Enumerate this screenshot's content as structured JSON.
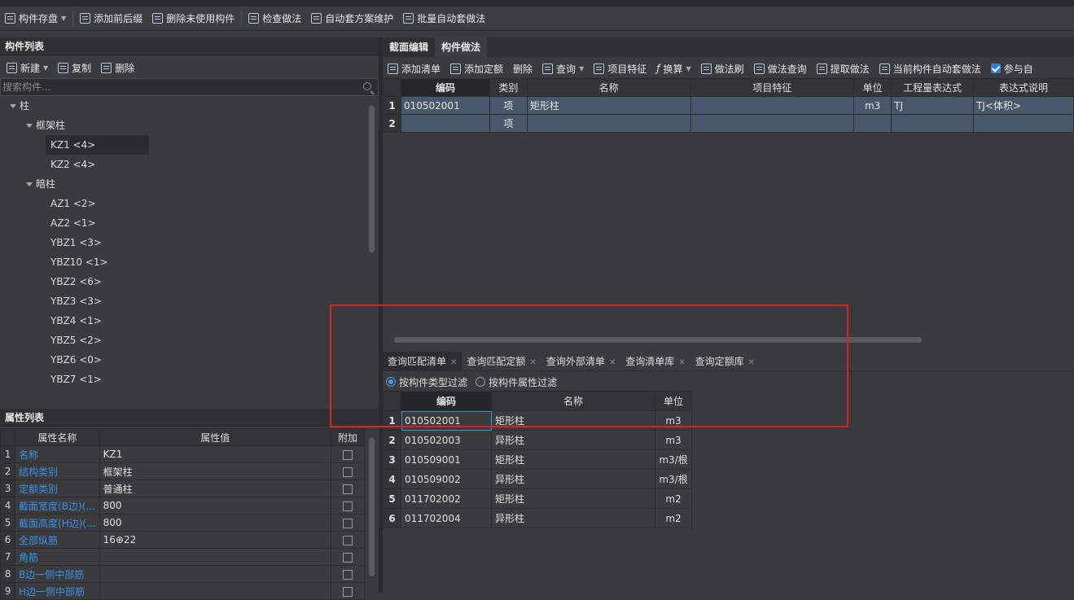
{
  "toolbar": {
    "items": [
      "构件存盘",
      "添加前后缀",
      "删除未使用构件",
      "检查做法",
      "自动套方案维护",
      "批量自动套做法"
    ]
  },
  "component_list": {
    "title": "构件列表",
    "tools": [
      "新建",
      "复制",
      "删除"
    ],
    "search_placeholder": "搜索构件...",
    "tree": {
      "root": "柱",
      "groups": [
        {
          "label": "框架柱",
          "items": [
            "KZ1 <4>",
            "KZ2 <4>"
          ]
        },
        {
          "label": "暗柱",
          "items": [
            "AZ1 <2>",
            "AZ2 <1>",
            "YBZ1 <3>",
            "YBZ10 <1>",
            "YBZ2 <6>",
            "YBZ3 <3>",
            "YBZ4 <1>",
            "YBZ5 <2>",
            "YBZ6 <0>",
            "YBZ7 <1>"
          ]
        }
      ],
      "selected": "KZ1 <4>"
    }
  },
  "property_list": {
    "title": "属性列表",
    "headers": [
      "属性名称",
      "属性值",
      "附加"
    ],
    "rows": [
      {
        "idx": "1",
        "name": "名称",
        "value": "KZ1"
      },
      {
        "idx": "2",
        "name": "结构类别",
        "value": "框架柱"
      },
      {
        "idx": "3",
        "name": "定额类别",
        "value": "普通柱"
      },
      {
        "idx": "4",
        "name": "截面宽度(B边)(...",
        "value": "800"
      },
      {
        "idx": "5",
        "name": "截面高度(H边)(...",
        "value": "800"
      },
      {
        "idx": "6",
        "name": "全部纵筋",
        "value": "16⊕22"
      },
      {
        "idx": "7",
        "name": "角筋",
        "value": ""
      },
      {
        "idx": "8",
        "name": "B边一侧中部筋",
        "value": ""
      },
      {
        "idx": "9",
        "name": "H边一侧中部筋",
        "value": ""
      }
    ]
  },
  "right_tabs": [
    "截面编辑",
    "构件做法"
  ],
  "method_tools": [
    "添加清单",
    "添加定额",
    "删除",
    "查询",
    "项目特征",
    "换算",
    "做法刷",
    "做法查询",
    "提取做法",
    "当前构件自动套做法",
    "参与自"
  ],
  "method_table": {
    "headers": [
      "编码",
      "类别",
      "名称",
      "项目特征",
      "单位",
      "工程量表达式",
      "表达式说明"
    ],
    "rows": [
      {
        "idx": "1",
        "code": "010502001",
        "cat": "项",
        "name": "矩形柱",
        "feature": "",
        "unit": "m3",
        "expr": "TJ",
        "desc": "TJ<体积>"
      },
      {
        "idx": "2",
        "code": "",
        "cat": "项",
        "name": "",
        "feature": "",
        "unit": "",
        "expr": "",
        "desc": ""
      }
    ]
  },
  "query_tabs": [
    "查询匹配清单",
    "查询匹配定额",
    "查询外部清单",
    "查询清单库",
    "查询定额库"
  ],
  "filters": [
    "按构件类型过滤",
    "按构件属性过滤"
  ],
  "query_table": {
    "headers": [
      "编码",
      "名称",
      "单位"
    ],
    "rows": [
      {
        "idx": "1",
        "code": "010502001",
        "name": "矩形柱",
        "unit": "m3"
      },
      {
        "idx": "2",
        "code": "010502003",
        "name": "异形柱",
        "unit": "m3"
      },
      {
        "idx": "3",
        "code": "010509001",
        "name": "矩形柱",
        "unit": "m3/根"
      },
      {
        "idx": "4",
        "code": "010509002",
        "name": "异形柱",
        "unit": "m3/根"
      },
      {
        "idx": "5",
        "code": "011702002",
        "name": "矩形柱",
        "unit": "m2"
      },
      {
        "idx": "6",
        "code": "011702004",
        "name": "异形柱",
        "unit": "m2"
      }
    ]
  },
  "colors": {
    "highlight_box": "#e0231f",
    "link_text": "#3e8fe0",
    "row_fill": "#46586a"
  }
}
